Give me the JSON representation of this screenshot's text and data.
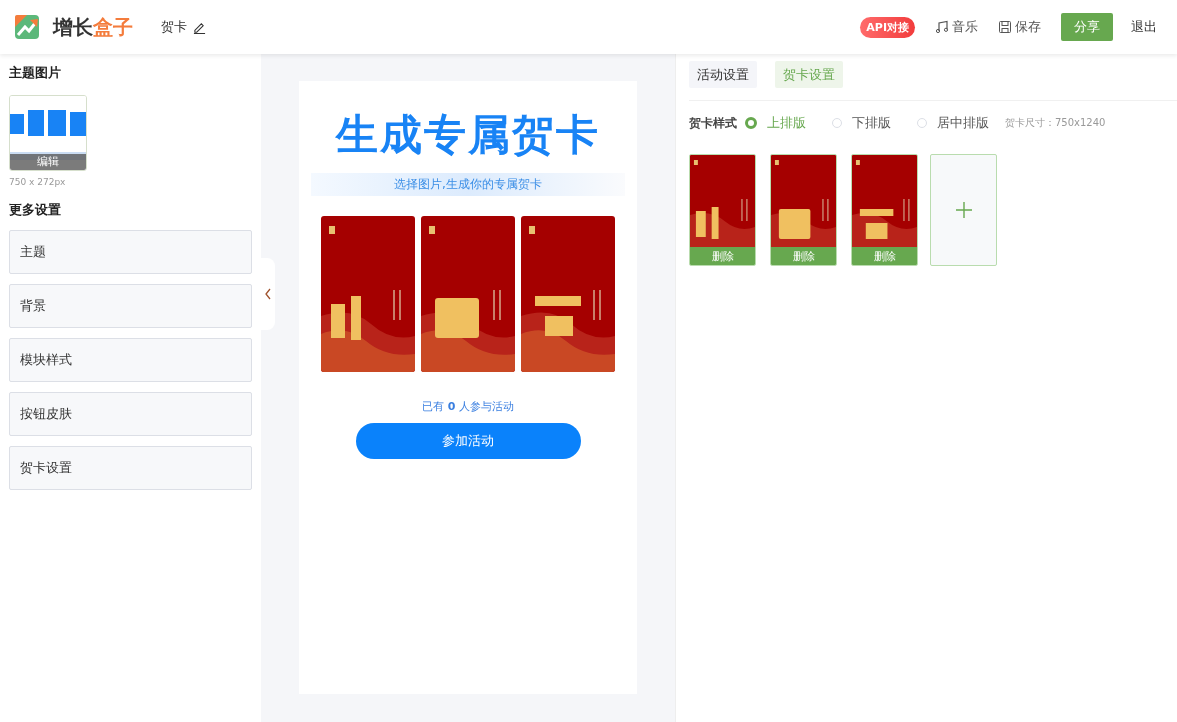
{
  "header": {
    "logo_dark": "增长",
    "logo_accent": "盒子",
    "doc_title": "贺卡",
    "api_badge": "API对接",
    "actions": [
      {
        "kind": "music",
        "label": "音乐"
      },
      {
        "kind": "save",
        "label": "保存"
      },
      {
        "kind": "share",
        "label": "分享"
      },
      {
        "kind": "exit",
        "label": "退出"
      }
    ]
  },
  "left": {
    "theme_title": "主题图片",
    "theme_image": {
      "kind": "picture",
      "edit_label": "编辑",
      "size": "750 x 272px"
    },
    "more_title": "更多设置",
    "items": [
      {
        "label": "主题"
      },
      {
        "label": "背景"
      },
      {
        "label": "模块样式"
      },
      {
        "label": "按钮皮肤"
      },
      {
        "label": "贺卡设置"
      }
    ]
  },
  "preview": {
    "title": "生成专属贺卡",
    "subtitle": "选择图片,生成你的专属贺卡",
    "count_prefix": "已有",
    "count": "0",
    "count_suffix": "人参与活动",
    "join_button": "参加活动"
  },
  "right": {
    "tabs": [
      {
        "label": "活动设置",
        "selected": false
      },
      {
        "label": "贺卡设置",
        "selected": true
      }
    ],
    "style_label": "贺卡样式",
    "layouts": [
      {
        "label": "上排版",
        "selected": true
      },
      {
        "label": "下排版",
        "selected": false
      },
      {
        "label": "居中排版",
        "selected": false
      }
    ],
    "size_note": "贺卡尺寸：750x1240",
    "cards": [
      {
        "kind": "picture",
        "delete_label": "删除"
      },
      {
        "kind": "picture",
        "delete_label": "删除"
      },
      {
        "kind": "picture",
        "delete_label": "删除"
      }
    ]
  }
}
